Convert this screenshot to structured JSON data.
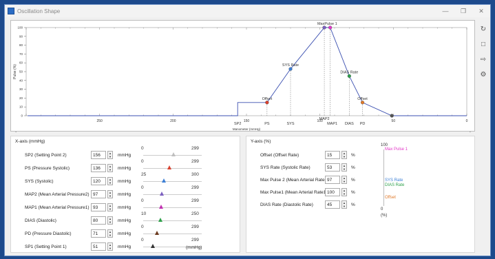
{
  "window": {
    "title": "Oscillation Shape"
  },
  "chart_data": {
    "type": "line",
    "xlabel": "Manometer (mmHg)",
    "ylabel": "Pulse (%)",
    "xlim": [
      300,
      0
    ],
    "ylim": [
      0,
      100
    ],
    "yticks": [
      0,
      10,
      20,
      30,
      40,
      50,
      60,
      70,
      80,
      90,
      100
    ],
    "xticks": [
      250,
      200,
      150,
      100,
      50,
      0
    ],
    "x": [
      299,
      156,
      156,
      136,
      120,
      97,
      93,
      80,
      71,
      51,
      0
    ],
    "y": [
      0,
      0,
      15,
      15,
      53,
      100,
      100,
      45,
      15,
      0,
      0
    ],
    "markers": [
      {
        "name": "Offset",
        "x": 136,
        "y": 15,
        "color": "#d9412f"
      },
      {
        "name": "SYS Rate",
        "x": 120,
        "y": 53,
        "color": "#3d7fd6"
      },
      {
        "name": "Max Pulse 2",
        "x": 97,
        "y": 100,
        "color": "#7b5fc0"
      },
      {
        "name": "Max Pulse 1",
        "x": 93,
        "y": 100,
        "color": "#e236c7"
      },
      {
        "name": "DIAS Rate",
        "x": 80,
        "y": 45,
        "color": "#2ea04a"
      },
      {
        "name": "Offset",
        "x": 71,
        "y": 15,
        "color": "#e07a2a"
      },
      {
        "name": "SP1",
        "x": 51,
        "y": 0,
        "color": "#555555"
      }
    ],
    "point_labels": [
      {
        "text": "Offset",
        "x": 136,
        "y": 15
      },
      {
        "text": "SYS Rate",
        "x": 120,
        "y": 53
      },
      {
        "text": "MaxPulse 1",
        "x": 95,
        "y": 100
      },
      {
        "text": "DIAS Rate",
        "x": 80,
        "y": 45
      },
      {
        "text": "Offset",
        "x": 71,
        "y": 15
      }
    ],
    "vline_labels": [
      {
        "text": "SP2",
        "x": 156
      },
      {
        "text": "PS",
        "x": 136
      },
      {
        "text": "SYS",
        "x": 120
      },
      {
        "text": "MAP2",
        "x": 97
      },
      {
        "text": "MAP1",
        "x": 93
      },
      {
        "text": "DIAS",
        "x": 80
      },
      {
        "text": "PD",
        "x": 71
      }
    ]
  },
  "sidebar": {
    "icons": [
      "refresh-icon",
      "export-icon",
      "import-icon",
      "settings-icon"
    ]
  },
  "xaxis": {
    "title": "X-axis (mmHg)",
    "unit": "mmHg",
    "footer": "(mmHg)",
    "rows": [
      {
        "label": "SP2 (Setting Point 2)",
        "value": "156",
        "min": "0",
        "max": "299",
        "thumb_color": "#bfbfbf",
        "level": 0.52
      },
      {
        "label": "PS (Pressure Systolic)",
        "value": "136",
        "min": "0",
        "max": "299",
        "thumb_color": "#d9412f",
        "level": 0.45
      },
      {
        "label": "SYS (Systolic)",
        "value": "120",
        "min": "25",
        "max": "300",
        "thumb_color": "#3d7fd6",
        "level": 0.35
      },
      {
        "label": "MAP2 (Mean Arterial Pressure2)",
        "value": "97",
        "min": "0",
        "max": "299",
        "thumb_color": "#7b5fc0",
        "level": 0.32
      },
      {
        "label": "MAP1 (Mean Arterial Pressure1)",
        "value": "93",
        "min": "0",
        "max": "299",
        "thumb_color": "#c030b0",
        "level": 0.31
      },
      {
        "label": "DIAS (Diastolic)",
        "value": "80",
        "min": "10",
        "max": "250",
        "thumb_color": "#2ea04a",
        "level": 0.29
      },
      {
        "label": "PD (Pressure Diastolic)",
        "value": "71",
        "min": "0",
        "max": "299",
        "thumb_color": "#6b3a1e",
        "level": 0.24
      },
      {
        "label": "SP1 (Setting Point 1)",
        "value": "51",
        "min": "0",
        "max": "299",
        "thumb_color": "#333333",
        "level": 0.17
      }
    ]
  },
  "yaxis": {
    "title": "Y-axis (%)",
    "unit": "%",
    "rows": [
      {
        "label": "Offset (Offset Rate)",
        "value": "15"
      },
      {
        "label": "SYS Rate (Systolic Rate)",
        "value": "53"
      },
      {
        "label": "Max Pulse 2 (Mean Arterial Rate2)",
        "value": "97"
      },
      {
        "label": "Max Pulse1 (Mean Arterial Rate1)",
        "value": "100"
      },
      {
        "label": "DIAS Rate (Diastolic Rate)",
        "value": "45"
      }
    ],
    "legend": {
      "top": "100",
      "bottom": "0",
      "unit": "(%)",
      "entries": [
        {
          "text": "Max Pulse 1",
          "color": "#e236c7"
        },
        {
          "text": "SYS Rate",
          "color": "#3d7fd6"
        },
        {
          "text": "DIAS Rate",
          "color": "#2ea04a"
        },
        {
          "text": "Offset",
          "color": "#e07a2a"
        }
      ]
    }
  }
}
